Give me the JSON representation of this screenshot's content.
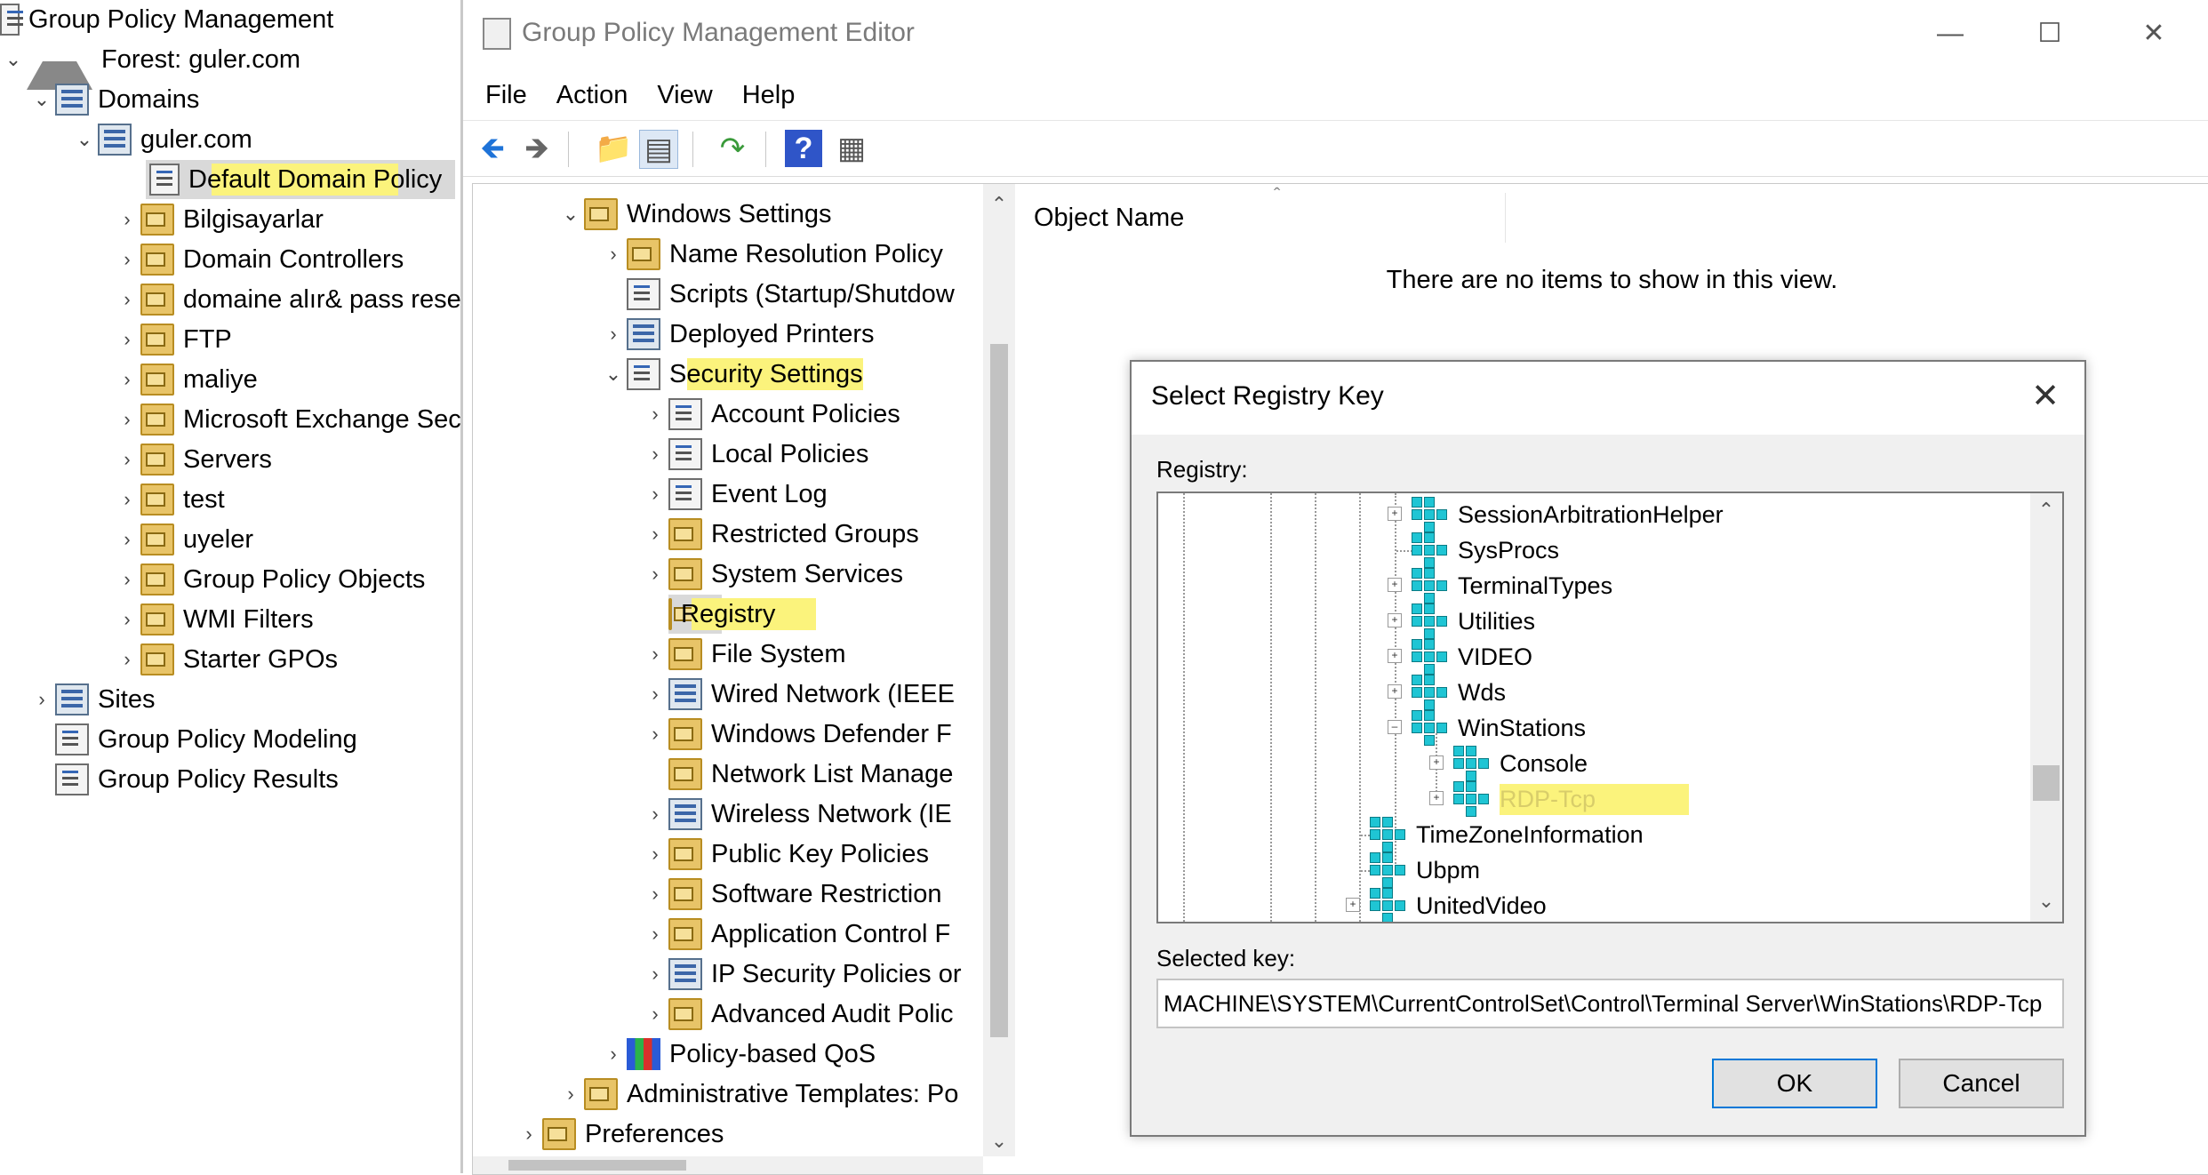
{
  "gpm": {
    "root": "Group Policy Management",
    "forest": "Forest: guler.com",
    "domains": "Domains",
    "domain": "guler.com",
    "items": [
      "Default Domain Policy",
      "Bilgisayarlar",
      "Domain Controllers",
      "domaine alır& pass rese",
      "FTP",
      "maliye",
      "Microsoft Exchange Sec",
      "Servers",
      "test",
      "uyeler",
      "Group Policy Objects",
      "WMI Filters",
      "Starter GPOs"
    ],
    "sites": "Sites",
    "modeling": "Group Policy Modeling",
    "results": "Group Policy Results"
  },
  "editor": {
    "title": "Group Policy Management Editor",
    "menu": [
      "File",
      "Action",
      "View",
      "Help"
    ],
    "tree": [
      "Windows Settings",
      "Name Resolution Policy",
      "Scripts (Startup/Shutdow",
      "Deployed Printers",
      "Security Settings",
      "Account Policies",
      "Local Policies",
      "Event Log",
      "Restricted Groups",
      "System Services",
      "Registry",
      "File System",
      "Wired Network (IEEE",
      "Windows Defender F",
      "Network List Manage",
      "Wireless Network (IE",
      "Public Key Policies",
      "Software Restriction",
      "Application Control F",
      "IP Security Policies or",
      "Advanced Audit Polic",
      "Policy-based QoS",
      "Administrative Templates: Po",
      "Preferences"
    ],
    "column_header": "Object Name",
    "empty_message": "There are no items to show in this view."
  },
  "dialog": {
    "title": "Select Registry Key",
    "registry_label": "Registry:",
    "keys": [
      "SessionArbitrationHelper",
      "SysProcs",
      "TerminalTypes",
      "Utilities",
      "VIDEO",
      "Wds",
      "WinStations",
      "Console",
      "RDP-Tcp",
      "TimeZoneInformation",
      "Ubpm",
      "UnitedVideo"
    ],
    "selected_key_label": "Selected key:",
    "selected_key_value": "MACHINE\\SYSTEM\\CurrentControlSet\\Control\\Terminal Server\\WinStations\\RDP-Tcp",
    "ok": "OK",
    "cancel": "Cancel"
  },
  "colors": {
    "highlight": "#fbf37c",
    "selection": "#d9d9d9",
    "primary_border": "#0078d7",
    "registry_key_icon": "#1fc5d4"
  }
}
